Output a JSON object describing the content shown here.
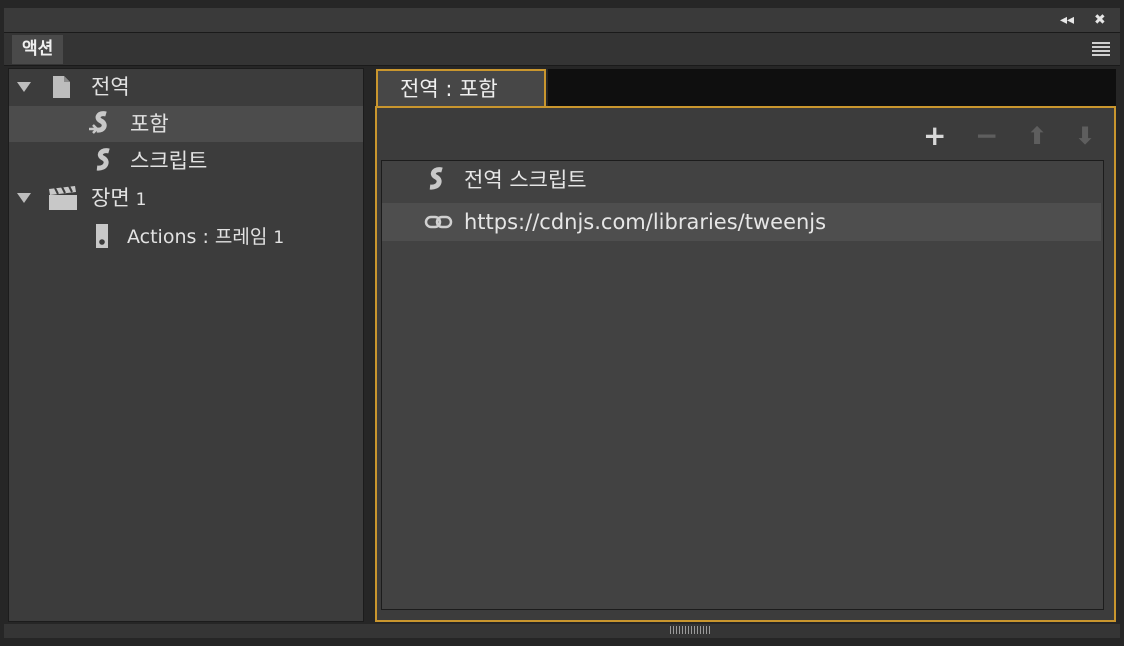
{
  "window": {
    "collapse_glyph": "◂◂",
    "close_glyph": "✖"
  },
  "panel_tab": {
    "label": "액션"
  },
  "tree": {
    "items": [
      {
        "label": "전역",
        "icon": "document-icon",
        "expanded": true
      },
      {
        "label": "포함",
        "icon": "include-script-icon",
        "selected": true
      },
      {
        "label": "스크립트",
        "icon": "script-icon"
      },
      {
        "label": "장면",
        "num": "1",
        "icon": "scene-clapper-icon",
        "expanded": true
      },
      {
        "label": "Actions : 프레임",
        "num": "1",
        "icon": "frame-icon"
      }
    ]
  },
  "editor": {
    "tab_label": "전역 : 포함",
    "toolbar": {
      "add_glyph": "+",
      "remove_glyph": "−",
      "up_glyph": "⬆",
      "down_glyph": "⬇"
    },
    "list": [
      {
        "label": "전역 스크립트",
        "icon": "script-icon"
      },
      {
        "label": "https://cdnjs.com/libraries/tweenjs",
        "icon": "link-icon"
      }
    ]
  },
  "colors": {
    "accent": "#c9962e",
    "panel_bg": "#3c3c3c",
    "selection_bg": "#4c4c4c"
  }
}
